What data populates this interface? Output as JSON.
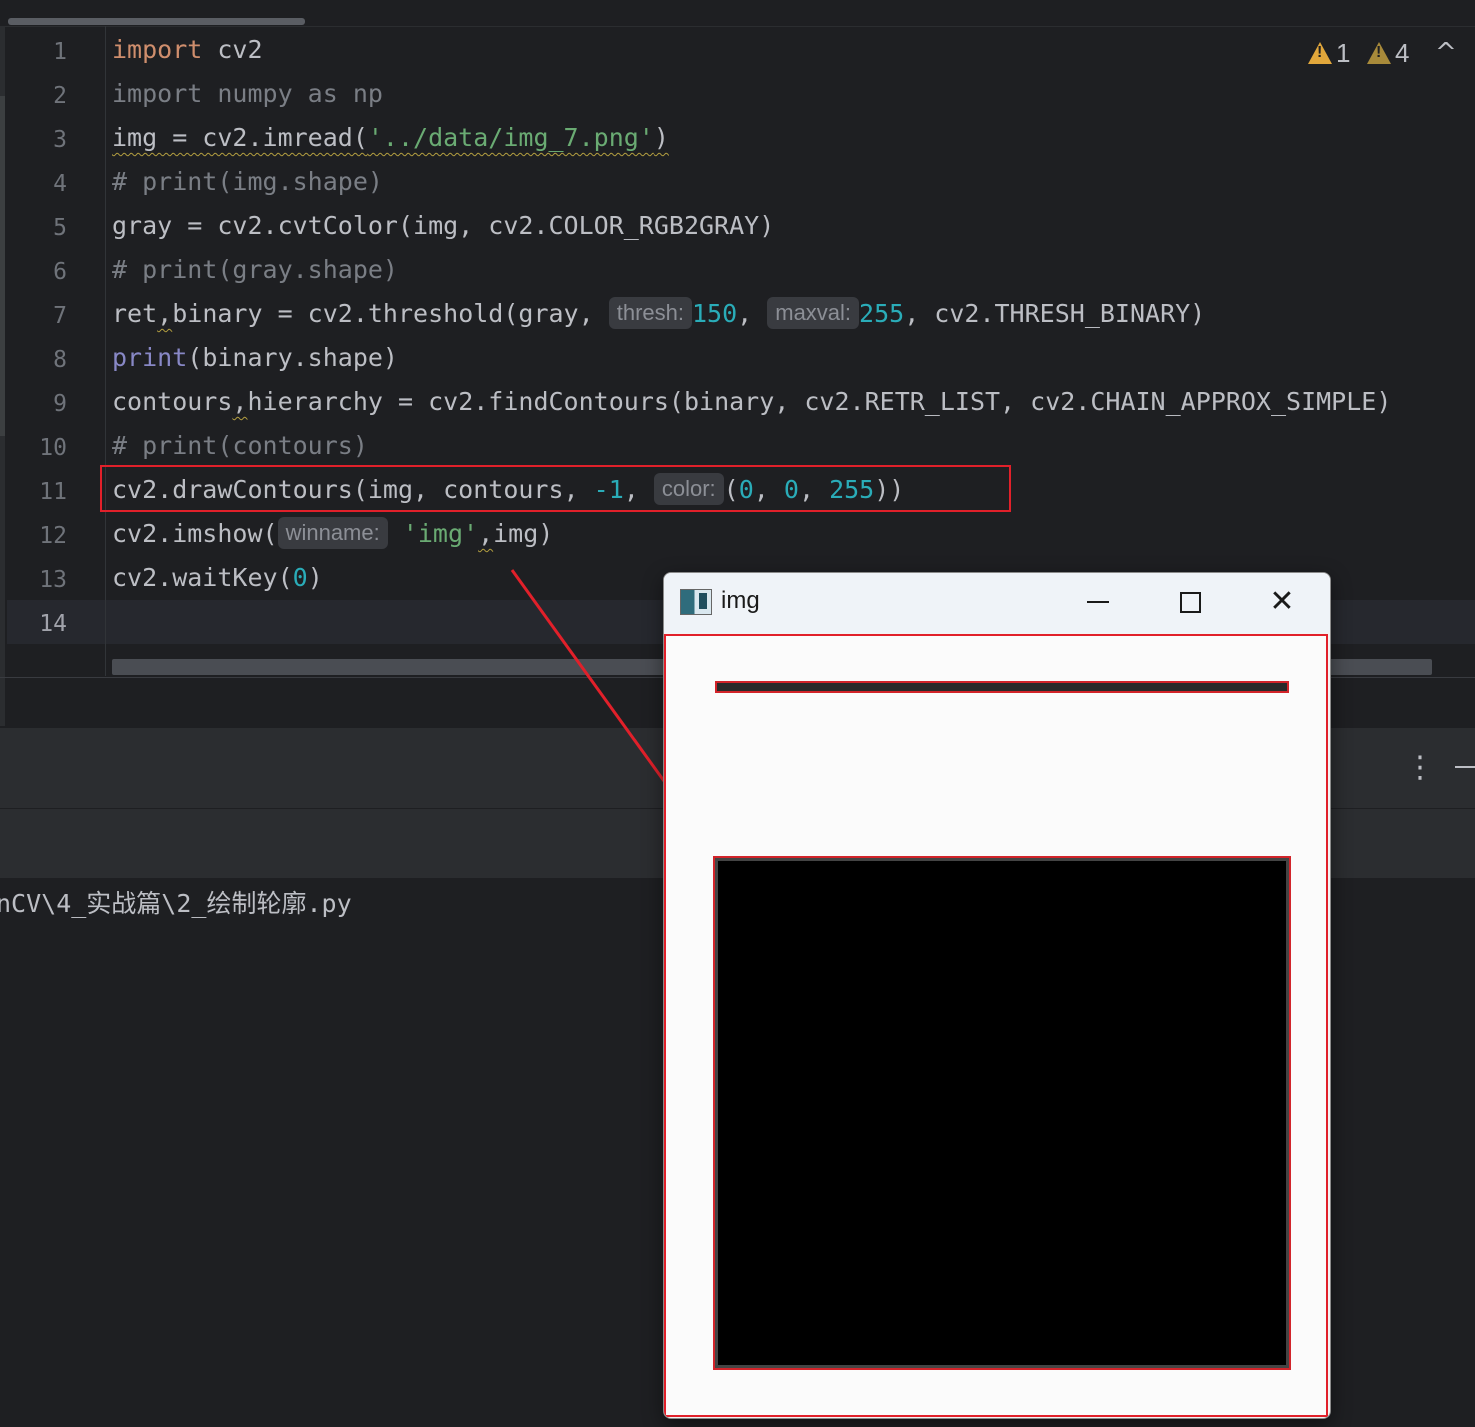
{
  "editor": {
    "line_numbers": [
      "1",
      "2",
      "3",
      "4",
      "5",
      "6",
      "7",
      "8",
      "9",
      "10",
      "11",
      "12",
      "13",
      "14"
    ],
    "code": {
      "l1": {
        "kw": "import",
        "rest": " cv2"
      },
      "l2": {
        "text": "import numpy as np"
      },
      "l3": {
        "a": "img = cv2.imread(",
        "str": "'../data/img_7.png'",
        "b": ")"
      },
      "l4": {
        "text": "# print(img.shape)"
      },
      "l5": {
        "text": "gray = cv2.cvtColor(img, cv2.COLOR_RGB2GRAY)"
      },
      "l6": {
        "text": "# print(gray.shape)"
      },
      "l7": {
        "a": "ret",
        "b": ",",
        "c": "binary = cv2.threshold(gray, ",
        "hint1": "thresh:",
        "n1": "150",
        "d": ", ",
        "hint2": "maxval:",
        "n2": "255",
        "e": ", cv2.THRESH_BINARY)"
      },
      "l8": {
        "fn": "print",
        "rest": "(binary.shape)"
      },
      "l9": {
        "a": "contours",
        "b": ",",
        "c": "hierarchy = cv2.findContours(binary, cv2.RETR_LIST, cv2.CHAIN_APPROX_SIMPLE)"
      },
      "l10": {
        "text": "# print(contours)"
      },
      "l11": {
        "a": "cv2.drawContours(img, contours, ",
        "n1": "-1",
        "b": ", ",
        "hint": "color:",
        "c": "(",
        "n2": "0",
        "d": ", ",
        "n3": "0",
        "e": ", ",
        "n4": "255",
        "f": "))"
      },
      "l12": {
        "a": "cv2.imshow(",
        "hint": "winname:",
        "str": "'img'",
        "b": ",",
        "c": "img)"
      },
      "l13": {
        "a": "cv2.waitKey(",
        "n": "0",
        "b": ")"
      },
      "l14": {
        "text": ""
      }
    },
    "inspections": {
      "errors": "1",
      "warnings": "4"
    },
    "chevron": "^"
  },
  "run_panel": {
    "console_line": "nCV\\4_实战篇\\2_绘制轮廓.py",
    "more_icon": "⋮"
  },
  "cv_window": {
    "title": "img",
    "minimize": "minimize-icon",
    "maximize": "maximize-icon",
    "close": "✕"
  },
  "colors": {
    "annotation_red": "#e1202a",
    "keyword": "#cf8e6d",
    "number": "#2aacb8",
    "string": "#6aab73"
  }
}
